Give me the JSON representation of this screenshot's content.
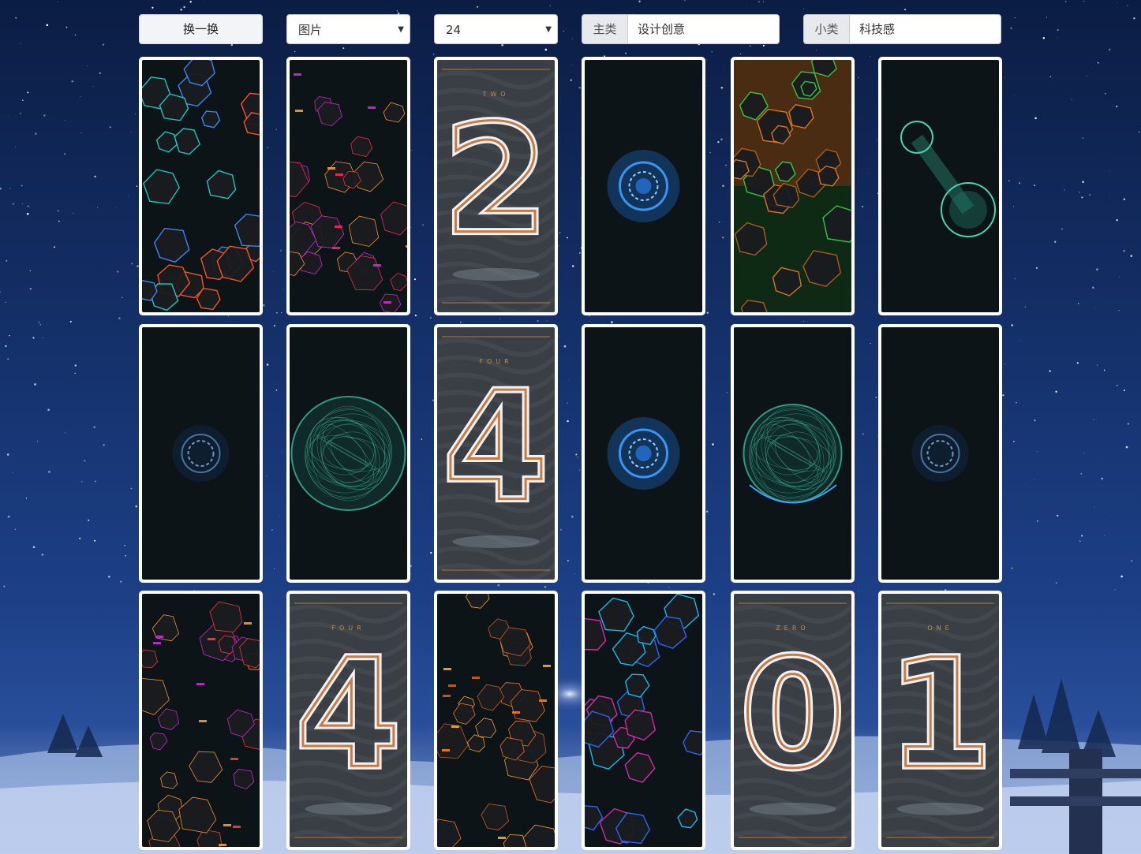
{
  "toolbar": {
    "refresh_label": "换一换",
    "type_select": {
      "selected": "图片"
    },
    "count_select": {
      "selected": "24"
    },
    "main_category": {
      "label": "主类",
      "value": "设计创意"
    },
    "sub_category": {
      "label": "小类",
      "value": "科技感"
    }
  },
  "thumbs": [
    {
      "kind": "voronoi",
      "theme": "orange-blue"
    },
    {
      "kind": "cracks",
      "theme": "magenta-orange"
    },
    {
      "kind": "digit",
      "word": "TWO",
      "digit": "2"
    },
    {
      "kind": "orb",
      "theme": "blue"
    },
    {
      "kind": "hex",
      "theme": "orange-green"
    },
    {
      "kind": "comet",
      "theme": "teal"
    },
    {
      "kind": "ring",
      "theme": "faint-blue"
    },
    {
      "kind": "globe",
      "theme": "teal"
    },
    {
      "kind": "digit",
      "word": "FOUR",
      "digit": "4"
    },
    {
      "kind": "orb",
      "theme": "blue"
    },
    {
      "kind": "sphere",
      "theme": "green"
    },
    {
      "kind": "ring",
      "theme": "faint-blue"
    },
    {
      "kind": "cracks",
      "theme": "orange-magenta"
    },
    {
      "kind": "digit",
      "word": "FOUR",
      "digit": "4"
    },
    {
      "kind": "cracks",
      "theme": "orange"
    },
    {
      "kind": "neon",
      "theme": "blue-magenta"
    },
    {
      "kind": "digit",
      "word": "ZERO",
      "digit": "0"
    },
    {
      "kind": "digit",
      "word": "ONE",
      "digit": "1"
    }
  ],
  "colors": {
    "sky_top": "#0b1d44",
    "sky_mid": "#1c3f86",
    "snow": "#9fb7e0"
  }
}
